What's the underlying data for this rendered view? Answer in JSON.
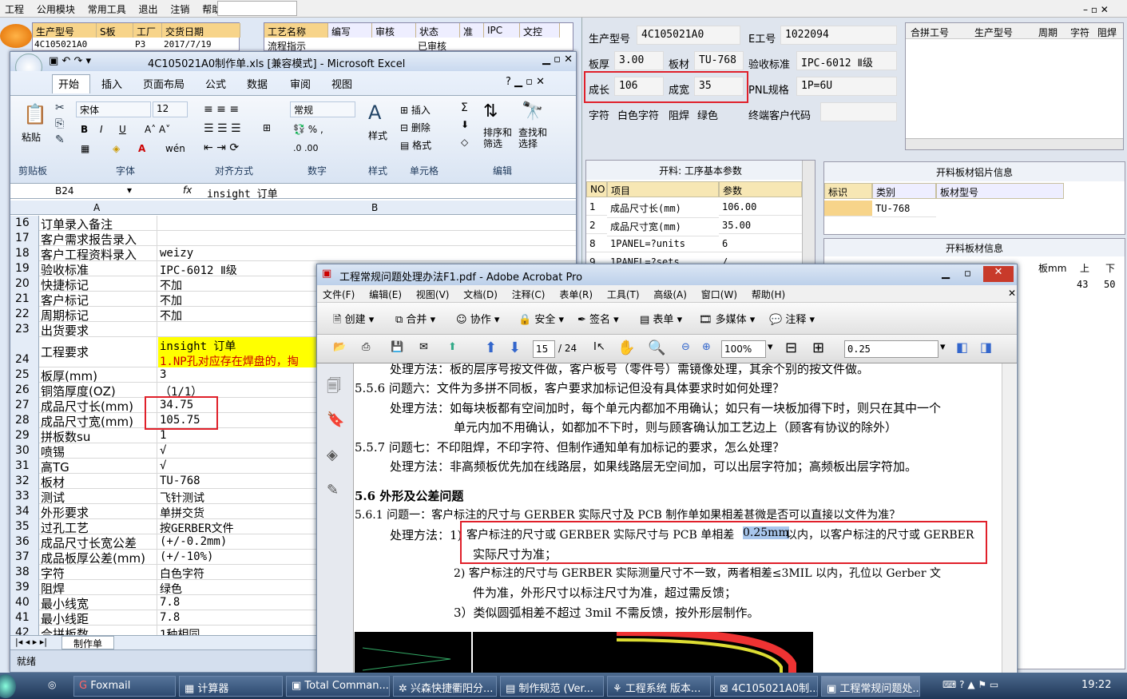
{
  "appmenu": {
    "items": [
      "工程",
      "公用模块",
      "常用工具",
      "退出",
      "注销",
      "帮助"
    ]
  },
  "leftgrid": {
    "headers": [
      "生产型号",
      "S板",
      "工厂",
      "交货日期"
    ],
    "row": [
      "4C105021A0",
      "",
      "P3",
      "2017/7/19"
    ],
    "headers2": [
      "工艺名称",
      "编写",
      "审核",
      "状态",
      "准",
      "IPC",
      "文控"
    ],
    "row2": [
      "流程指示",
      "",
      "",
      "已审核"
    ]
  },
  "rightpanel": {
    "fields": [
      {
        "label": "生产型号",
        "value": "4C105021A0"
      },
      {
        "label": "E工号",
        "value": "1022094"
      },
      {
        "label": "板厚",
        "value": "3.00"
      },
      {
        "label": "板材",
        "value": "TU-768"
      },
      {
        "label": "验收标准",
        "value": "IPC-6012 Ⅱ级"
      },
      {
        "label": "成长",
        "value": "106"
      },
      {
        "label": "成宽",
        "value": "35"
      },
      {
        "label": "PNL规格",
        "value": "1P=6U"
      },
      {
        "label": "字符",
        "value": "白色字符"
      },
      {
        "label": "阻焊",
        "value": "绿色"
      },
      {
        "label": "终端客户代码",
        "value": ""
      }
    ],
    "mergegrid": {
      "headers": [
        "合拼工号",
        "生产型号",
        "周期",
        "字符",
        "阻焊"
      ]
    },
    "process": {
      "title": "开料: 工序基本参数",
      "headers": [
        "NO",
        "项目",
        "参数"
      ],
      "rows": [
        [
          "1",
          "成品尺寸长(mm)",
          "106.00"
        ],
        [
          "2",
          "成品尺寸宽(mm)",
          "35.00"
        ],
        [
          "8",
          "1PANEL=?units",
          "6"
        ],
        [
          "9",
          "1PANEL=?sets",
          "/"
        ]
      ]
    },
    "material": {
      "title": "开料板材铝片信息",
      "headers": [
        "标识",
        "类别",
        "板材型号"
      ],
      "rows": [
        [
          "",
          "TU-768",
          ""
        ]
      ]
    },
    "material2": {
      "title": "开料板材信息",
      "headers": [
        "板mm",
        "上",
        "下"
      ],
      "values": [
        "43",
        "50"
      ]
    }
  },
  "excel": {
    "title": "4C105021A0制作单.xls [兼容模式] - Microsoft Excel",
    "tabs": [
      "开始",
      "插入",
      "页面布局",
      "公式",
      "数据",
      "审阅",
      "视图"
    ],
    "font": "宋体",
    "size": "12",
    "numfmt": "常规",
    "groups": [
      "剪贴板",
      "字体",
      "对齐方式",
      "数字",
      "样式",
      "单元格",
      "编辑"
    ],
    "buttons": {
      "paste": "粘贴",
      "style": "样式",
      "insert": "插入",
      "delete": "删除",
      "format": "格式",
      "sort": "排序和\n筛选",
      "find": "查找和\n选择"
    },
    "namebox": "B24",
    "formula": "insight 订单",
    "colA": "A",
    "colB": "B",
    "rows": [
      {
        "n": "16",
        "a": "订单录入备注",
        "b": ""
      },
      {
        "n": "17",
        "a": "客户需求报告录入",
        "b": ""
      },
      {
        "n": "18",
        "a": "客户工程资料录入",
        "b": "weizy"
      },
      {
        "n": "19",
        "a": "验收标准",
        "b": "IPC-6012 Ⅱ级"
      },
      {
        "n": "20",
        "a": "快捷标记",
        "b": "不加"
      },
      {
        "n": "21",
        "a": "客户标记",
        "b": "不加"
      },
      {
        "n": "22",
        "a": "周期标记",
        "b": "不加"
      },
      {
        "n": "23",
        "a": "出货要求",
        "b": ""
      },
      {
        "n": "24",
        "a": "工程要求",
        "b": "insight 订单",
        "b2": "1.NP孔对应存在焊盘的，掏"
      },
      {
        "n": "25",
        "a": "板厚(mm)",
        "b": "3"
      },
      {
        "n": "26",
        "a": "铜箔厚度(OZ)",
        "b": "（1/1）"
      },
      {
        "n": "27",
        "a": "成品尺寸长(mm)",
        "b": "34.75"
      },
      {
        "n": "28",
        "a": "成品尺寸宽(mm)",
        "b": "105.75"
      },
      {
        "n": "29",
        "a": "拼板数su",
        "b": "1"
      },
      {
        "n": "30",
        "a": "喷锡",
        "b": "√"
      },
      {
        "n": "31",
        "a": "高TG",
        "b": "√"
      },
      {
        "n": "32",
        "a": "板材",
        "b": "TU-768"
      },
      {
        "n": "33",
        "a": "测试",
        "b": "飞针测试"
      },
      {
        "n": "34",
        "a": "外形要求",
        "b": "单拼交货"
      },
      {
        "n": "35",
        "a": "过孔工艺",
        "b": "按GERBER文件"
      },
      {
        "n": "36",
        "a": "成品尺寸长宽公差",
        "b": "(+/-0.2mm)"
      },
      {
        "n": "37",
        "a": "成品板厚公差(mm)",
        "b": "(+/-10%)"
      },
      {
        "n": "38",
        "a": "字符",
        "b": "白色字符"
      },
      {
        "n": "39",
        "a": "阻焊",
        "b": "绿色"
      },
      {
        "n": "40",
        "a": "最小线宽",
        "b": "7.8"
      },
      {
        "n": "41",
        "a": "最小线距",
        "b": "7.8"
      },
      {
        "n": "42",
        "a": "合拼板数",
        "b": "1种相同"
      }
    ],
    "sheettab": "制作单",
    "status": "就绪"
  },
  "acrobat": {
    "title": "工程常规问题处理办法F1.pdf - Adobe Acrobat Pro",
    "menu": [
      "文件(F)",
      "编辑(E)",
      "视图(V)",
      "文档(D)",
      "注释(C)",
      "表单(R)",
      "工具(T)",
      "高级(A)",
      "窗口(W)",
      "帮助(H)"
    ],
    "tools": [
      "创建",
      "合并",
      "协作",
      "安全",
      "签名",
      "表单",
      "多媒体",
      "注释"
    ],
    "page": "15",
    "pages": "/ 24",
    "zoom": "100%",
    "search": "0.25",
    "lines": [
      "处理方法：板的层序号按文件做，客户板号（零件号）需镜像处理，其余个别的按文件做。",
      "5.5.6  问题六：文件为多拼不同板，客户要求加标记但没有具体要求时如何处理？",
      "处理方法：如每块板都有空间加时，每个单元内都加不用确认；如只有一块板加得下时，则只在其中一个",
      "单元内加不用确认，如都加不下时，则与顾客确认加工艺边上（顾客有协议的除外）",
      "5.5.7  问题七：不印阻焊，不印字符、但制作通知单有加标记的要求，怎么处理？",
      "处理方法：非高频板优先加在线路层，如果线路层无空间加，可以出层字符加；高频板出层字符加。",
      "5.6 外形及公差问题",
      "5.6.1  问题一：客户标注的尺寸与 GERBER 实际尺寸及 PCB 制作单如果相差甚微是否可以直接以文件为准？",
      "处理方法：1)",
      "客户标注的尺寸或 GERBER 实际尺寸与 PCB 单相差",
      "0.25mm",
      "以内，以客户标注的尺寸或 GERBER",
      "实际尺寸为准；",
      "2)  客户标注的尺寸与 GERBER 实际测量尺寸不一致，两者相差≤3MIL 以内，孔位以 Gerber 文",
      "件为准，外形尺寸以标注尺寸为准，超过需反馈；",
      "3）类似圆弧相差不超过 3mil 不需反馈，按外形层制作。"
    ]
  },
  "taskbar": {
    "items": [
      "Foxmail",
      "计算器",
      "Total Comman...",
      "兴森快捷衢阳分...",
      "制作规范 (Ver...",
      "工程系统  版本...",
      "4C105021A0制...",
      "工程常规问题处..."
    ],
    "clock": "19:22"
  }
}
